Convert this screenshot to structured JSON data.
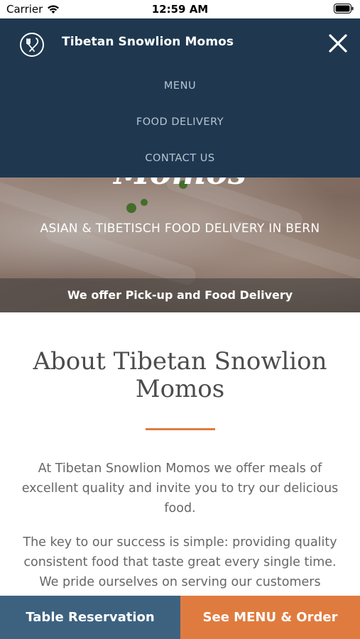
{
  "status_bar": {
    "carrier": "Carrier",
    "time": "12:59 AM"
  },
  "nav": {
    "brand": "Tibetan Snowlion Momos",
    "links": [
      "MENU",
      "FOOD DELIVERY",
      "CONTACT US"
    ]
  },
  "hero": {
    "title": "Momos",
    "subtitle": "ASIAN & TIBETISCH FOOD DELIVERY IN BERN",
    "band": "We offer Pick-up and Food Delivery"
  },
  "about": {
    "title": "About Tibetan Snowlion Momos",
    "paragraphs": [
      "At Tibetan Snowlion Momos we offer meals of excellent quality and invite you to try our delicious food.",
      "The key to our success is simple: providing quality consistent food that taste great every single time. We pride ourselves on serving our customers"
    ]
  },
  "bottom_bar": {
    "reserve_label": "Table Reservation",
    "order_label": "See MENU & Order"
  },
  "colors": {
    "nav_bg": "#1f3850",
    "accent_orange": "#e07b3f",
    "reserve_blue": "#3d6280"
  }
}
